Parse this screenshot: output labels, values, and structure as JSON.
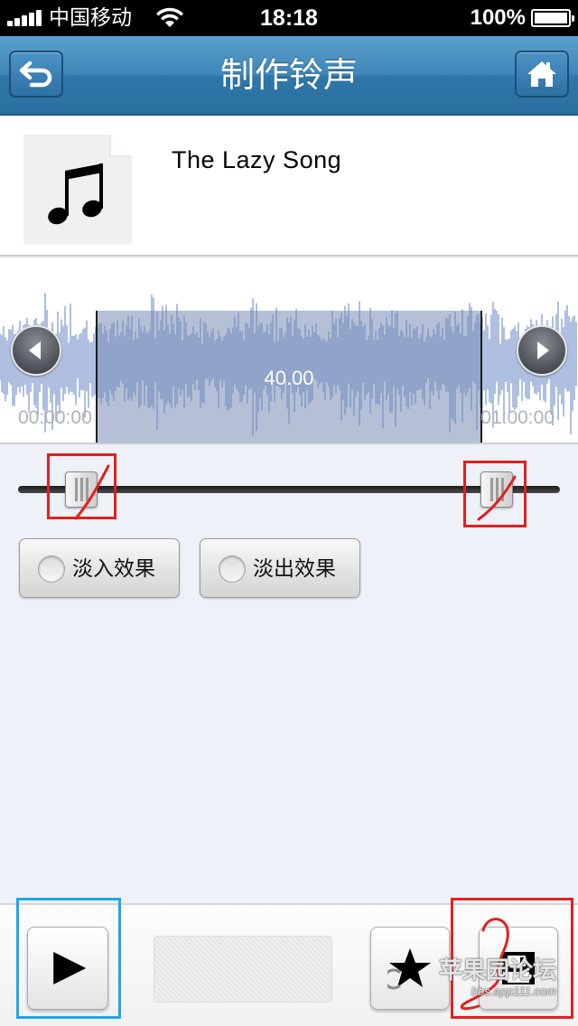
{
  "status_bar": {
    "carrier": "中国移动",
    "time": "18:18",
    "battery": "100%",
    "battery_level": 1.0,
    "icons": [
      "signal-bars-icon",
      "wifi-icon",
      "battery-icon"
    ]
  },
  "nav": {
    "title": "制作铃声",
    "back_icon": "back-arrow-icon",
    "home_icon": "home-icon"
  },
  "song": {
    "title": "The Lazy Song",
    "art_icon": "music-note-icon"
  },
  "waveform": {
    "selection_duration": "40.00",
    "start_time": "00:00:00",
    "end_time": "01:00:00",
    "left_arrow_icon": "arrow-left-icon",
    "right_arrow_icon": "arrow-right-icon"
  },
  "fade": {
    "fade_in_label": "淡入效果",
    "fade_out_label": "淡出效果",
    "fade_in_checked": false,
    "fade_out_checked": false
  },
  "toolbar": {
    "play_icon": "play-icon",
    "favorite_icon": "star-icon",
    "save_icon": "save-icon"
  },
  "watermark": {
    "main": "苹果园论坛",
    "sub": "bbs.app111.com"
  },
  "colors": {
    "nav_bar": "#3e86b8",
    "selection": "#8796b8",
    "annotation_red": "#e32020",
    "annotation_blue": "#1ea8e8"
  }
}
